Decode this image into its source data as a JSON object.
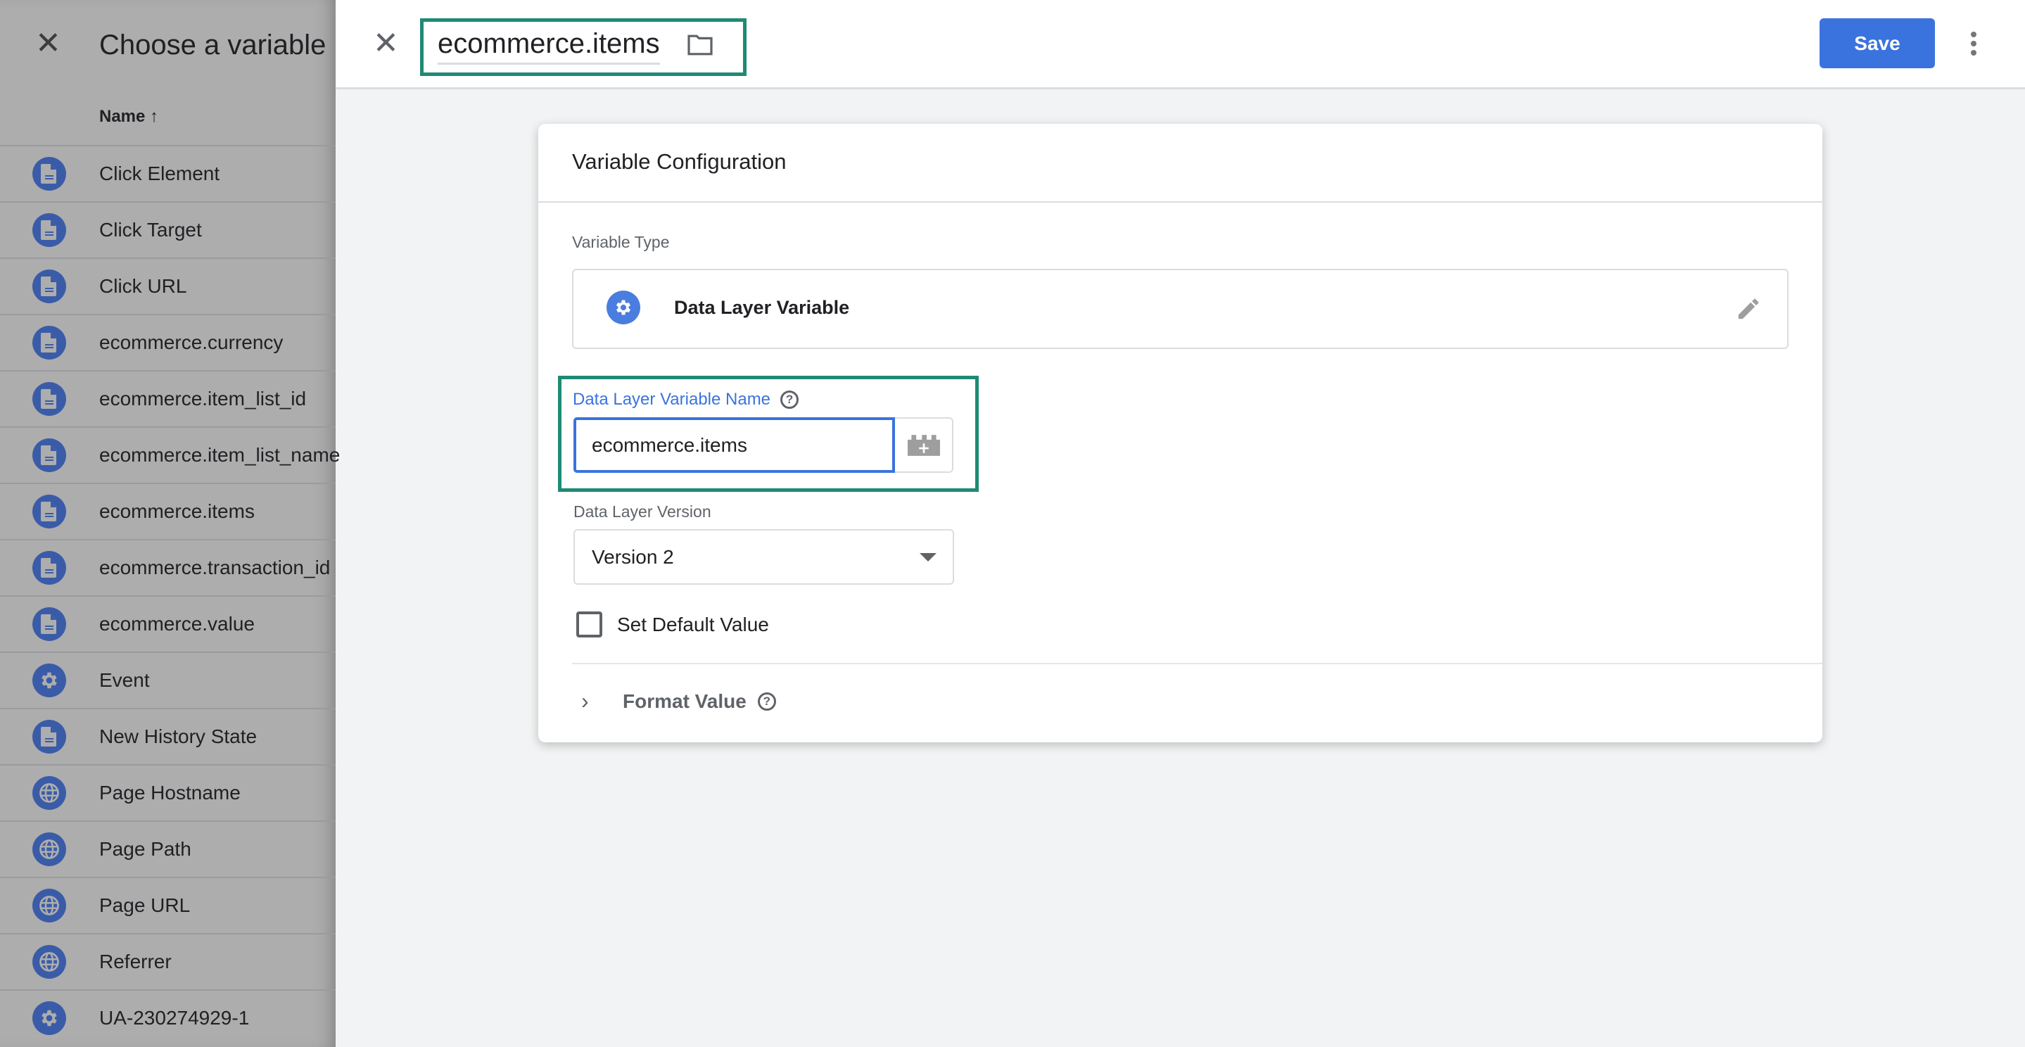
{
  "chooser": {
    "title": "Choose a variable",
    "close_icon": "close-icon",
    "column_header": "Name",
    "sort_icon": "arrow-up-icon",
    "items": [
      {
        "label": "Click Element",
        "icon": "document-icon"
      },
      {
        "label": "Click Target",
        "icon": "document-icon"
      },
      {
        "label": "Click URL",
        "icon": "document-icon"
      },
      {
        "label": "ecommerce.currency",
        "icon": "document-icon"
      },
      {
        "label": "ecommerce.item_list_id",
        "icon": "document-icon"
      },
      {
        "label": "ecommerce.item_list_name",
        "icon": "document-icon"
      },
      {
        "label": "ecommerce.items",
        "icon": "document-icon"
      },
      {
        "label": "ecommerce.transaction_id",
        "icon": "document-icon"
      },
      {
        "label": "ecommerce.value",
        "icon": "document-icon"
      },
      {
        "label": "Event",
        "icon": "gear-icon"
      },
      {
        "label": "New History State",
        "icon": "document-icon"
      },
      {
        "label": "Page Hostname",
        "icon": "globe-icon"
      },
      {
        "label": "Page Path",
        "icon": "globe-icon"
      },
      {
        "label": "Page URL",
        "icon": "globe-icon"
      },
      {
        "label": "Referrer",
        "icon": "globe-icon"
      },
      {
        "label": "UA-230274929-1",
        "icon": "gear-icon"
      }
    ]
  },
  "editor": {
    "variable_name": "ecommerce.items",
    "save_label": "Save",
    "card_title": "Variable Configuration",
    "variable_type_label": "Variable Type",
    "variable_type": "Data Layer Variable",
    "dlv_name_label": "Data Layer Variable Name",
    "dlv_name_value": "ecommerce.items",
    "dl_version_label": "Data Layer Version",
    "dl_version_value": "Version 2",
    "set_default_label": "Set Default Value",
    "set_default_checked": false,
    "format_value_label": "Format Value",
    "help_glyph": "?"
  },
  "colors": {
    "accent": "#3b73de",
    "highlight": "#1f8a74",
    "icon_circle": "#3a5ca8"
  }
}
